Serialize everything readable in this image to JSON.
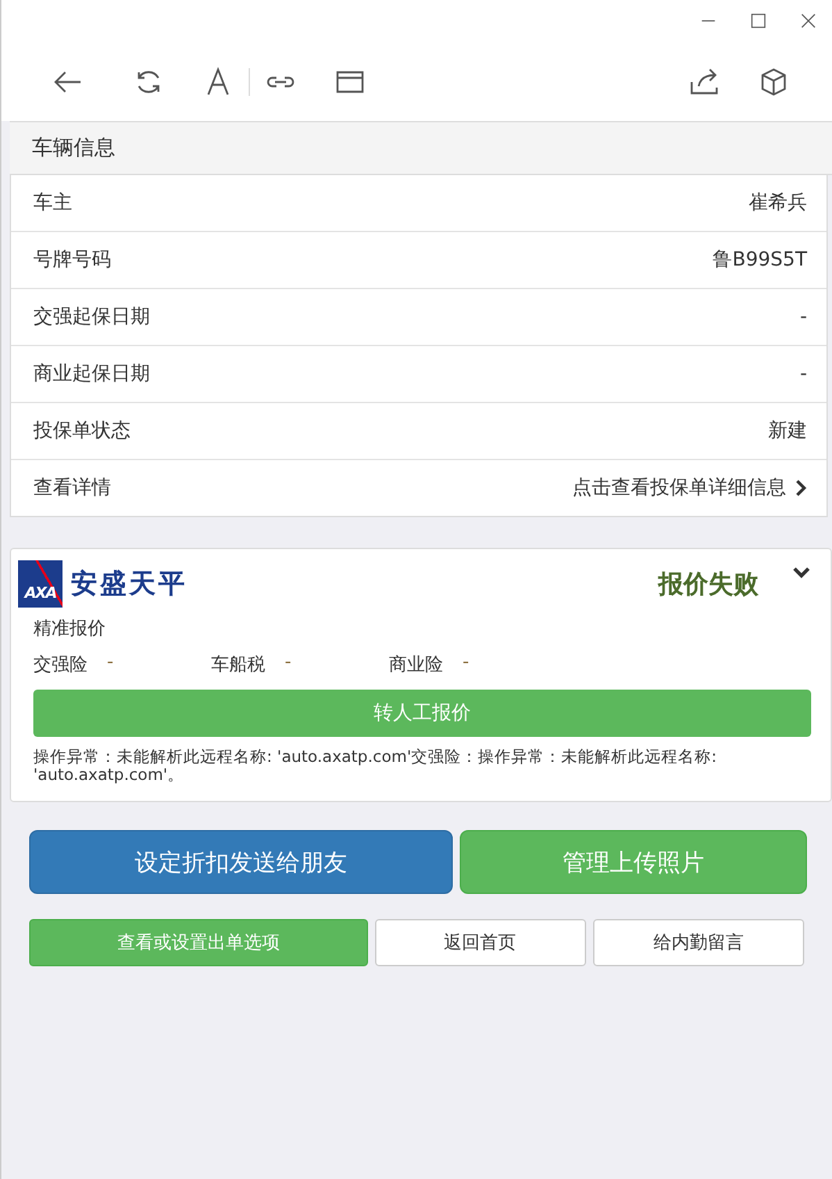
{
  "section_title": "车辆信息",
  "vehicle_rows": [
    {
      "label": "车主",
      "value": "崔希兵",
      "kind": "plain"
    },
    {
      "label": "号牌号码",
      "value": "鲁B99S5T",
      "kind": "plain"
    },
    {
      "label": "交强起保日期",
      "value": "-",
      "kind": "plain"
    },
    {
      "label": "商业起保日期",
      "value": "-",
      "kind": "plain"
    },
    {
      "label": "投保单状态",
      "value": "新建",
      "kind": "plain"
    },
    {
      "label": "查看详情",
      "value": "点击查看投保单详细信息",
      "kind": "link"
    }
  ],
  "quote": {
    "company": "安盛天平",
    "logo": "AXA",
    "status": "报价失败",
    "expanded": false,
    "type": "精准报价",
    "premiums": [
      {
        "label": "交强险",
        "value": "-"
      },
      {
        "label": "车船税",
        "value": "-"
      },
      {
        "label": "商业险",
        "value": "-"
      }
    ],
    "manual_button": "转人工报价",
    "error": "操作异常：未能解析此远程名称: 'auto.axatp.com'交强险：操作异常：未能解析此远程名称: 'auto.axatp.com'。"
  },
  "main_buttons": [
    {
      "label": "设定折扣发送给朋友",
      "kind": "primary"
    },
    {
      "label": "管理上传照片",
      "kind": "success"
    }
  ],
  "small_buttons": [
    {
      "label": "查看或设置出单选项",
      "kind": "success"
    },
    {
      "label": "返回首页",
      "kind": "default"
    },
    {
      "label": "给内勤留言",
      "kind": "default"
    }
  ]
}
